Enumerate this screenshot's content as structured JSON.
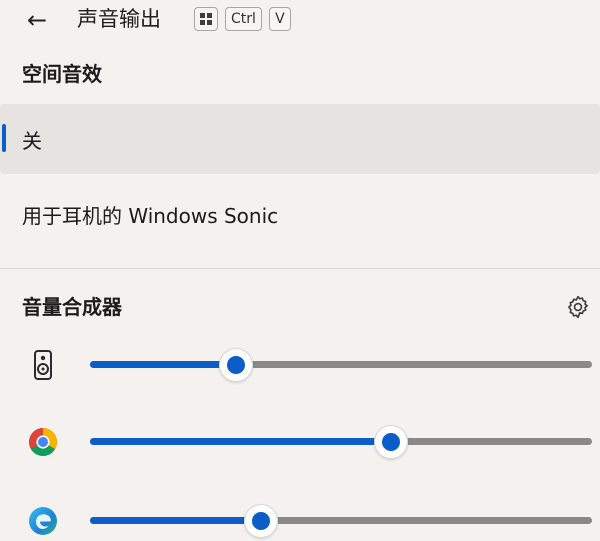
{
  "header": {
    "back_icon": "arrow-left-icon",
    "title": "声音输出",
    "shortcut": {
      "win_icon": "windows-logo-icon",
      "ctrl": "Ctrl",
      "v": "V"
    }
  },
  "spatial_audio": {
    "title": "空间音效",
    "options": [
      {
        "label": "关",
        "selected": true
      },
      {
        "label": "用于耳机的 Windows Sonic",
        "selected": false
      }
    ]
  },
  "volume_mixer": {
    "title": "音量合成器",
    "settings_icon": "gear-icon",
    "accent_color": "#0b5ec8",
    "apps": [
      {
        "icon": "speaker-device-icon",
        "volume_fraction": 0.29
      },
      {
        "icon": "chrome-icon",
        "volume_fraction": 0.6
      },
      {
        "icon": "edge-icon",
        "volume_fraction": 0.34
      }
    ]
  }
}
